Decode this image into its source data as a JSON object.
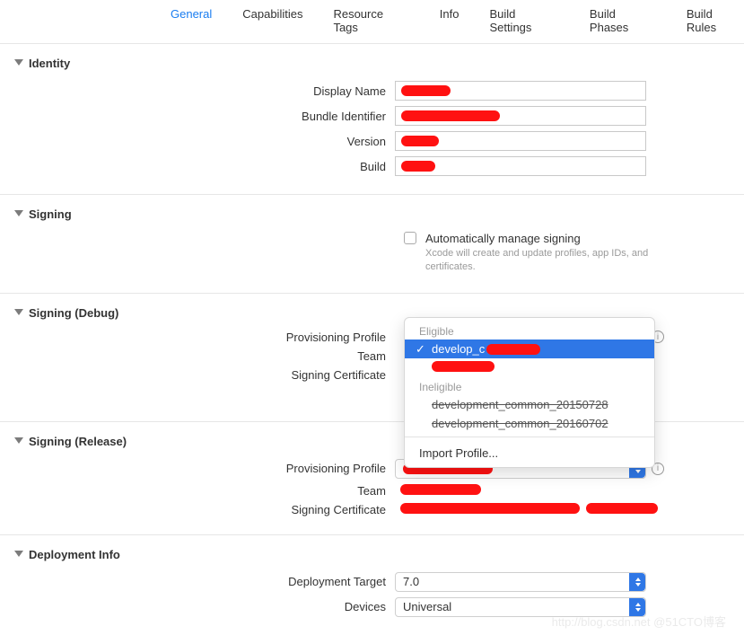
{
  "tabs": {
    "general": "General",
    "capabilities": "Capabilities",
    "resource_tags": "Resource Tags",
    "info": "Info",
    "build_settings": "Build Settings",
    "build_phases": "Build Phases",
    "build_rules": "Build Rules"
  },
  "identity": {
    "title": "Identity",
    "display_name_label": "Display Name",
    "bundle_id_label": "Bundle Identifier",
    "version_label": "Version",
    "build_label": "Build"
  },
  "signing": {
    "title": "Signing",
    "auto_label": "Automatically manage signing",
    "auto_desc": "Xcode will create and update profiles, app IDs, and certificates."
  },
  "signing_debug": {
    "title": "Signing (Debug)",
    "profile_label": "Provisioning Profile",
    "team_label": "Team",
    "cert_label": "Signing Certificate"
  },
  "popup": {
    "eligible": "Eligible",
    "selected": "develop_c",
    "ineligible": "Ineligible",
    "import": "Import Profile..."
  },
  "signing_release": {
    "title": "Signing (Release)",
    "profile_label": "Provisioning Profile",
    "team_label": "Team",
    "cert_label": "Signing Certificate"
  },
  "deployment": {
    "title": "Deployment Info",
    "target_label": "Deployment Target",
    "target_value": "7.0",
    "devices_label": "Devices",
    "devices_value": "Universal"
  },
  "watermark": "http://blog.csdn.net  @51CTO博客"
}
